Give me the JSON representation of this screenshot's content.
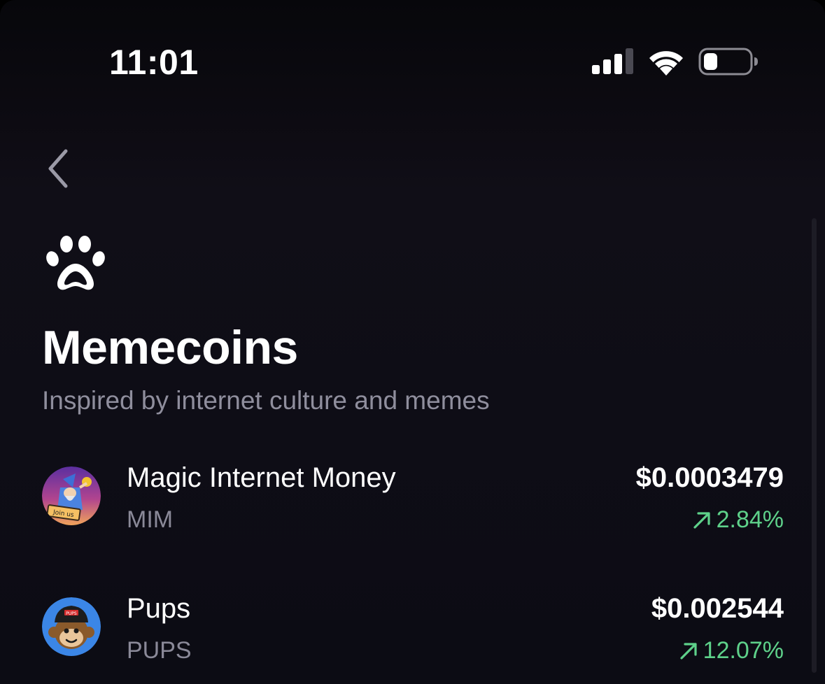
{
  "status_bar": {
    "time": "11:01",
    "icons": [
      "cellular-signal-icon",
      "wifi-icon",
      "battery-icon"
    ]
  },
  "navigation": {
    "back_icon": "chevron-left-icon"
  },
  "category": {
    "icon": "paw-icon",
    "title": "Memecoins",
    "subtitle": "Inspired by internet culture and memes"
  },
  "coins": [
    {
      "name": "Magic Internet Money",
      "symbol": "MIM",
      "price": "$0.0003479",
      "change": "2.84%",
      "direction": "up",
      "avatar_icon": "wizard-avatar-icon",
      "avatar_caption": "Join us"
    },
    {
      "name": "Pups",
      "symbol": "PUPS",
      "price": "$0.002544",
      "change": "12.07%",
      "direction": "up",
      "avatar_icon": "monkey-avatar-icon",
      "avatar_caption": "PUPS"
    }
  ],
  "colors": {
    "background": "#0e0d16",
    "positive": "#5ed18a",
    "secondary_text": "#8f8e9d",
    "primary_text": "#ffffff"
  }
}
